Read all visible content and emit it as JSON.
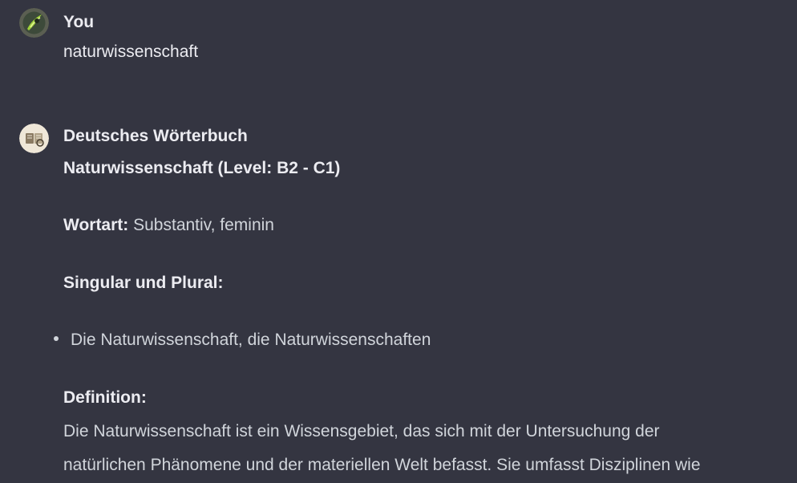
{
  "conversation": {
    "user_message": {
      "author": "You",
      "text": "naturwissenschaft"
    },
    "assistant_message": {
      "author": "Deutsches Wörterbuch",
      "heading": "Naturwissenschaft (Level: B2 - C1)",
      "wortart_label": "Wortart:",
      "wortart_value": " Substantiv, feminin",
      "singular_plural_label": "Singular und Plural:",
      "singular_plural_items": [
        "Die Naturwissenschaft, die Naturwissenschaften"
      ],
      "definition_label": "Definition:",
      "definition_text_line1": "Die Naturwissenschaft ist ein Wissensgebiet, das sich mit der Untersuchung der",
      "definition_text_line2": "natürlichen Phänomene und der materiellen Welt befasst. Sie umfasst Disziplinen wie"
    }
  },
  "icons": {
    "user_avatar": "user-avatar-icon",
    "assistant_avatar": "dictionary-avatar-icon"
  },
  "colors": {
    "background": "#343541",
    "text": "#d1d5db",
    "text_strong": "#ececf1"
  }
}
